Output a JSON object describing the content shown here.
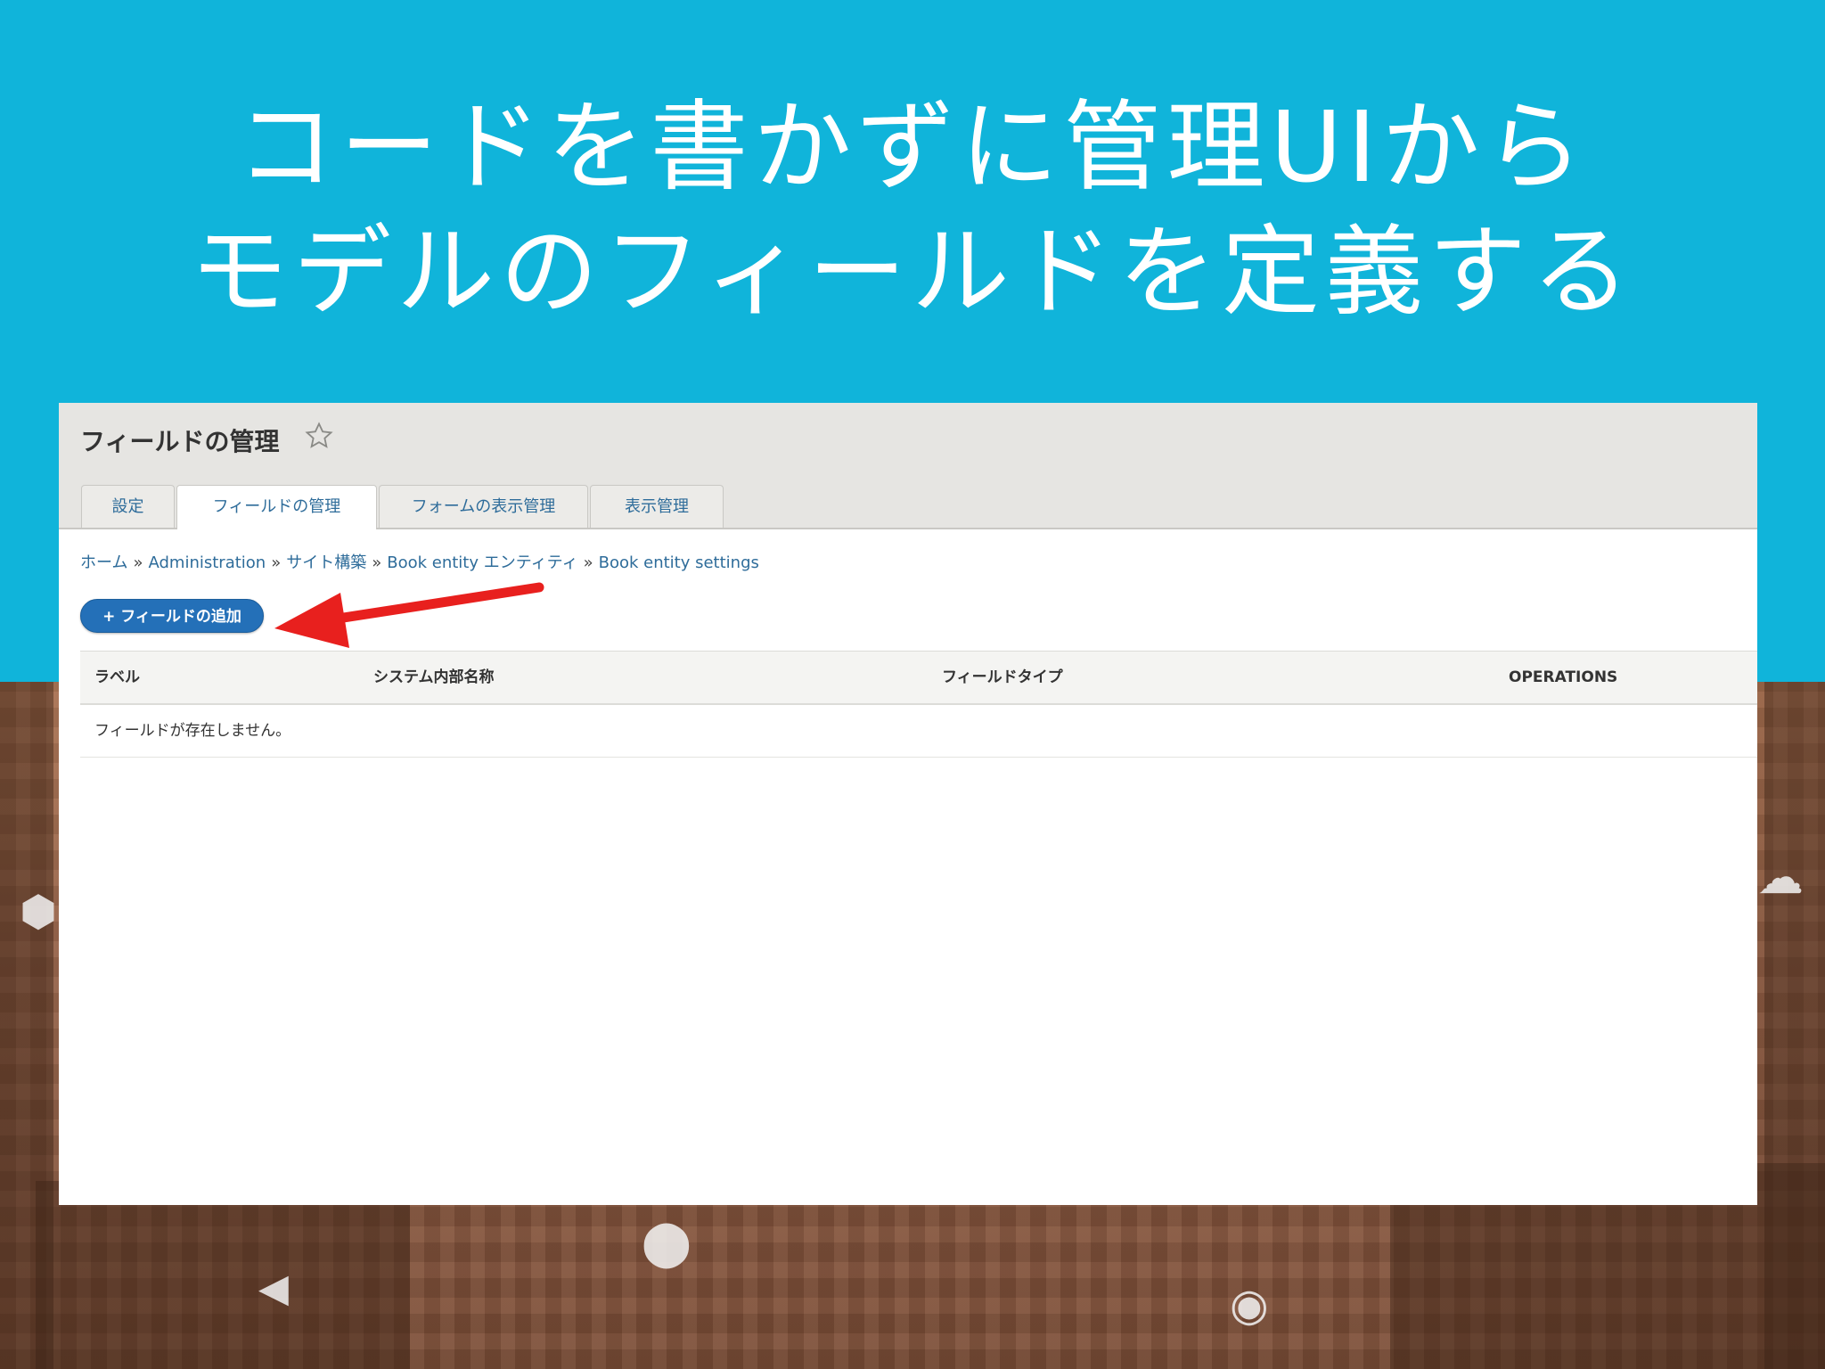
{
  "slide": {
    "title_line1": "コードを書かずに管理UIから",
    "title_line2": "モデルのフィールドを定義する"
  },
  "admin": {
    "page_title": "フィールドの管理",
    "tabs": [
      {
        "label": "設定",
        "active": false
      },
      {
        "label": "フィールドの管理",
        "active": true
      },
      {
        "label": "フォームの表示管理",
        "active": false
      },
      {
        "label": "表示管理",
        "active": false
      }
    ],
    "breadcrumb": [
      "ホーム",
      "Administration",
      "サイト構築",
      "Book entity エンティティ",
      "Book entity settings"
    ],
    "breadcrumb_separator": "»",
    "add_button_label": "+ フィールドの追加",
    "table": {
      "headers": [
        "ラベル",
        "システム内部名称",
        "フィールドタイプ",
        "OPERATIONS"
      ],
      "empty_message": "フィールドが存在しません。"
    }
  },
  "colors": {
    "slide_background": "#10b4da",
    "link": "#2e6c9a",
    "button": "#2470b8",
    "arrow": "#e8201e"
  }
}
